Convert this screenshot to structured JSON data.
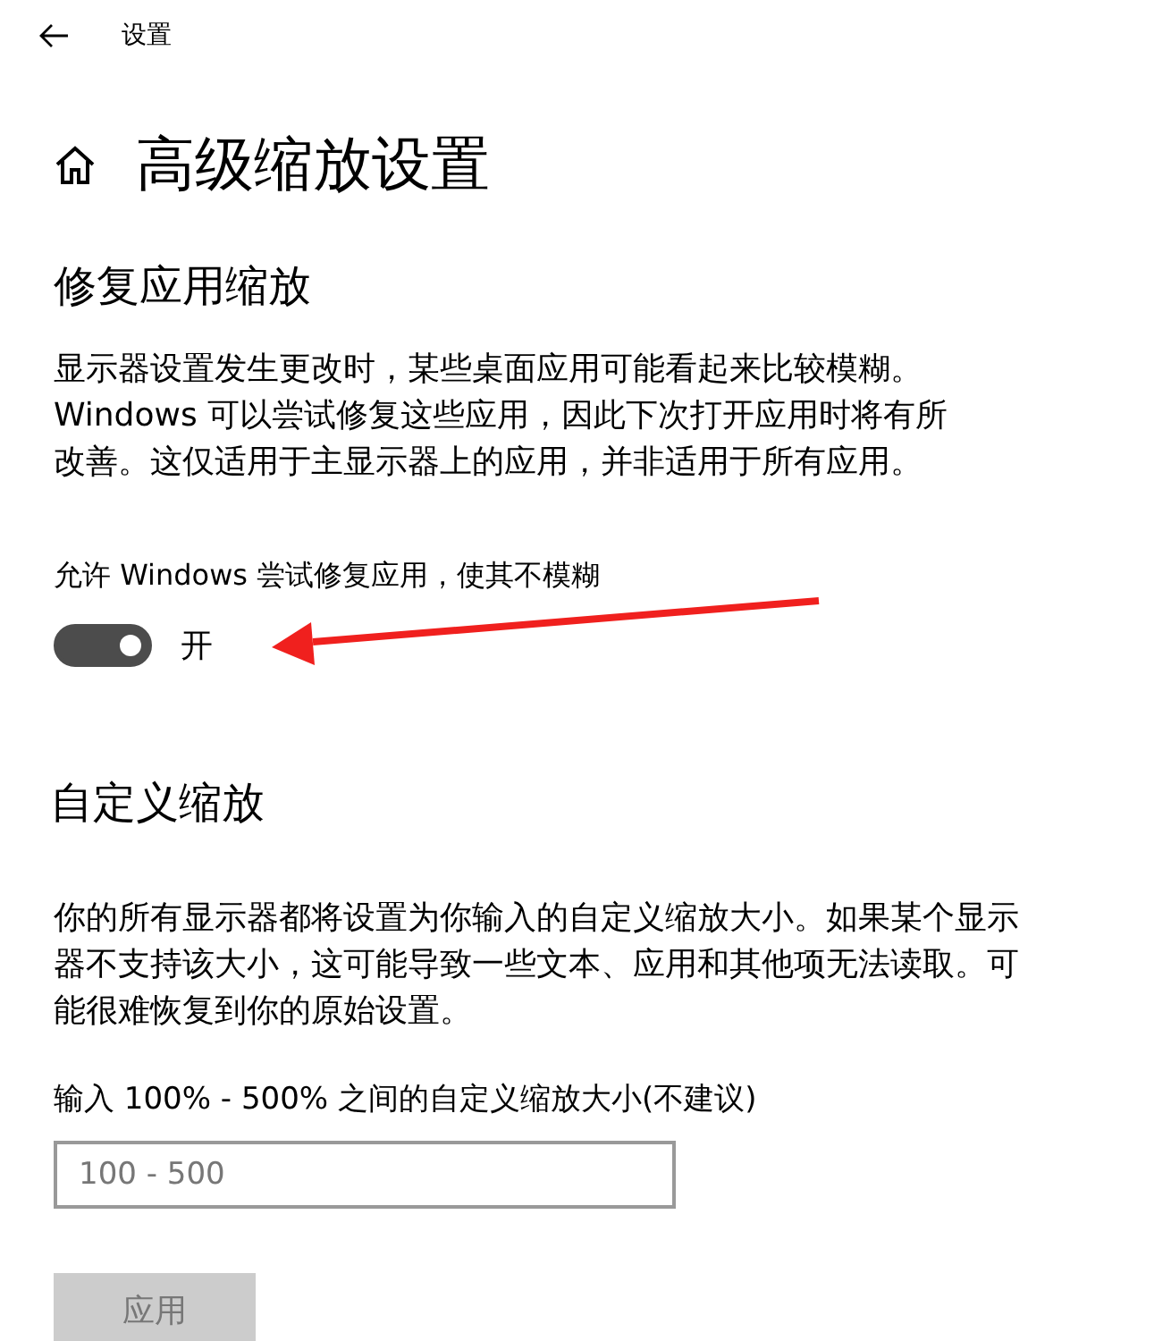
{
  "window": {
    "title": "设置"
  },
  "page": {
    "heading": "高级缩放设置"
  },
  "fix_scaling": {
    "heading": "修复应用缩放",
    "description": "显示器设置发生更改时，某些桌面应用可能看起来比较模糊。Windows 可以尝试修复这些应用，因此下次打开应用时将有所改善。这仅适用于主显示器上的应用，并非适用于所有应用。",
    "toggle": {
      "label": "允许 Windows 尝试修复应用，使其不模糊",
      "on": true,
      "state_text": "开"
    }
  },
  "custom_scaling": {
    "heading": "自定义缩放",
    "description": "你的所有显示器都将设置为你输入的自定义缩放大小。如果某个显示器不支持该大小，这可能导致一些文本、应用和其他项无法读取。可能很难恢复到你的原始设置。",
    "field_label": "输入 100% - 500% 之间的自定义缩放大小(不建议)",
    "field": {
      "placeholder": "100 - 500"
    },
    "apply_button": {
      "label": "应用",
      "disabled": true
    }
  },
  "annotation": {
    "kind": "arrow"
  }
}
